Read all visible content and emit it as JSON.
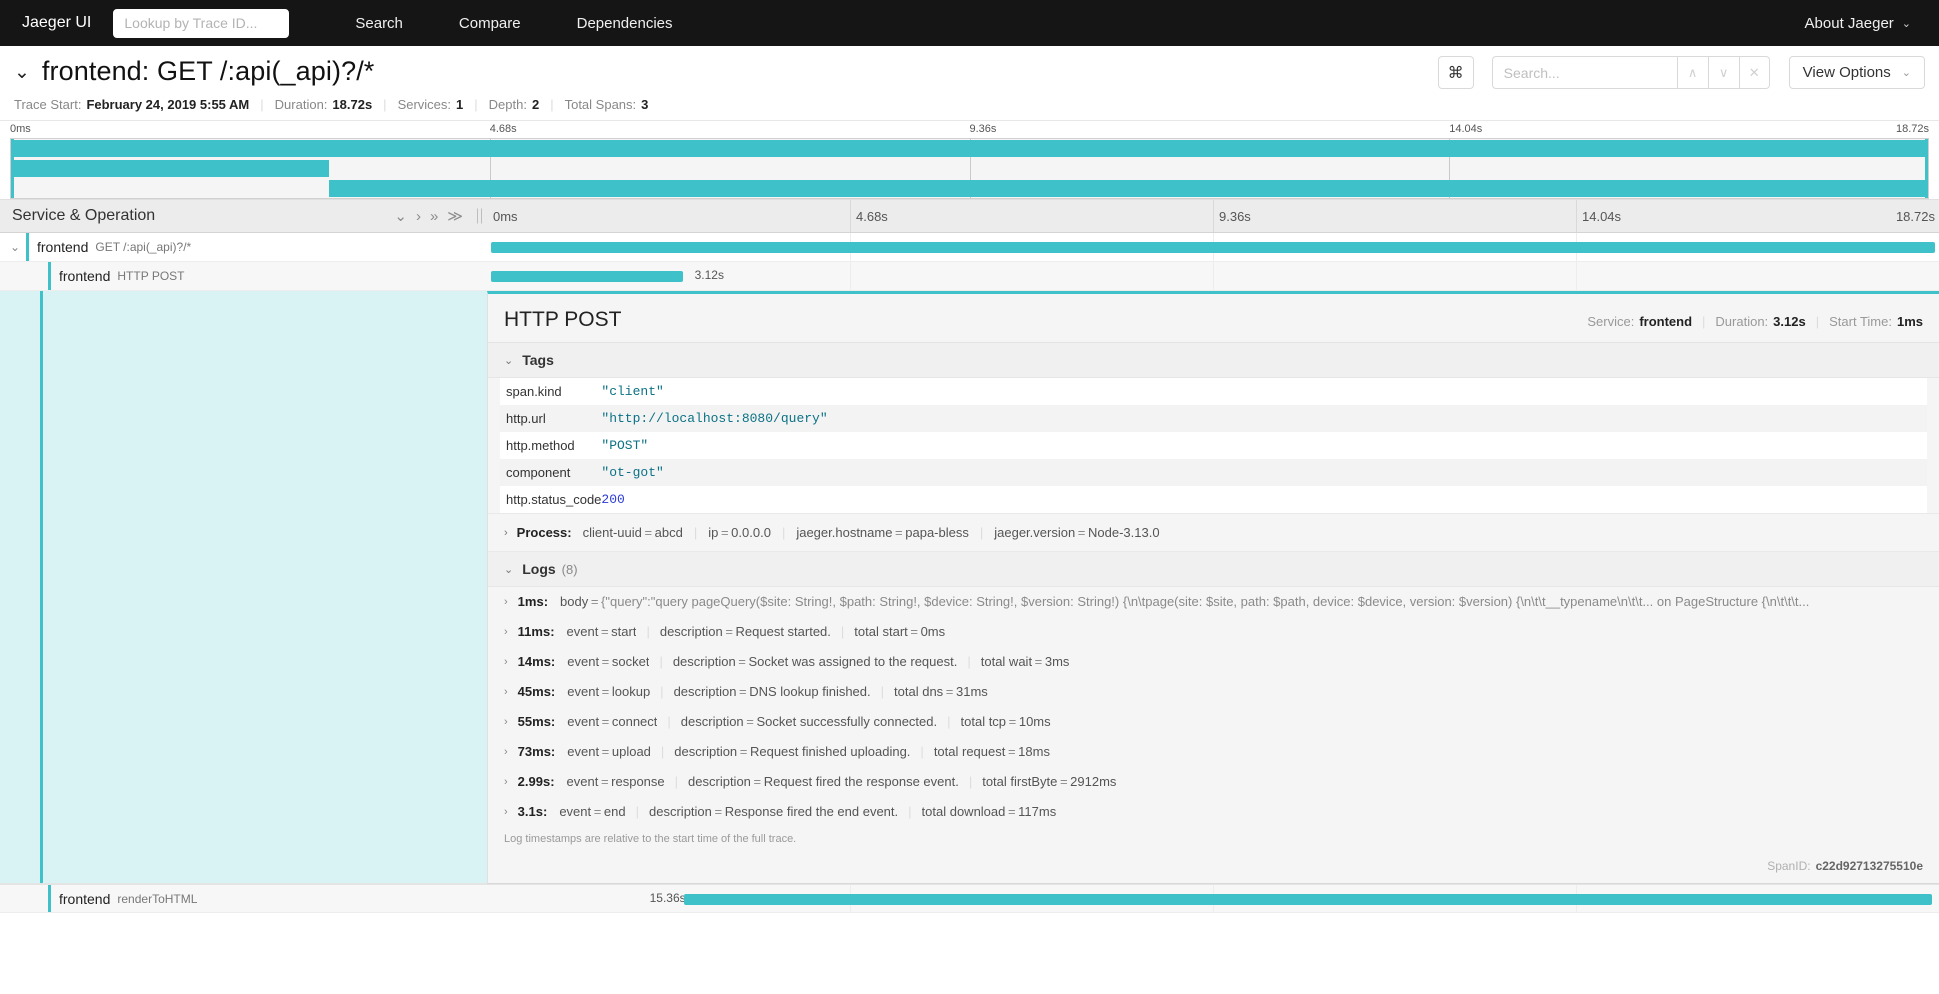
{
  "topnav": {
    "brand": "Jaeger UI",
    "trace_lookup_placeholder": "Lookup by Trace ID...",
    "trace_lookup_value": "",
    "links": [
      {
        "label": "Search"
      },
      {
        "label": "Compare"
      },
      {
        "label": "Dependencies"
      }
    ],
    "about": "About Jaeger",
    "about_caret": "⌄"
  },
  "trace": {
    "collapse_caret": "⌄",
    "title": "frontend: GET /:api(_api)?/*",
    "meta": [
      {
        "label": "Trace Start:",
        "value": "February 24, 2019 5:55 AM"
      },
      {
        "label": "Duration:",
        "value": "18.72s"
      },
      {
        "label": "Services:",
        "value": "1"
      },
      {
        "label": "Depth:",
        "value": "2"
      },
      {
        "label": "Total Spans:",
        "value": "3"
      }
    ]
  },
  "tools": {
    "kbd_icon": "⌘",
    "search_placeholder": "Search...",
    "search_value": "",
    "prev_icon": "∧",
    "next_icon": "∨",
    "clear_icon": "✕",
    "view_options": "View Options",
    "view_options_caret": "⌄"
  },
  "minimap": {
    "ticks": [
      {
        "label": "0ms",
        "pct": 0
      },
      {
        "label": "4.68s",
        "pct": 25
      },
      {
        "label": "9.36s",
        "pct": 50
      },
      {
        "label": "14.04s",
        "pct": 75
      },
      {
        "label": "18.72s",
        "pct": 100
      }
    ],
    "rows": [
      {
        "left_pct": 0,
        "width_pct": 100
      },
      {
        "left_pct": 0,
        "width_pct": 16.6
      },
      {
        "left_pct": 16.6,
        "width_pct": 83.4
      }
    ]
  },
  "columns": {
    "left_header": "Service & Operation",
    "actions": [
      {
        "icon": "⌄",
        "name": "collapse-one-icon"
      },
      {
        "icon": "›",
        "name": "expand-one-icon"
      },
      {
        "icon": "»",
        "name": "collapse-all-icon"
      },
      {
        "icon": "≫",
        "name": "expand-all-icon"
      }
    ],
    "ticks": [
      {
        "label": "0ms",
        "pct": 0
      },
      {
        "label": "4.68s",
        "pct": 25
      },
      {
        "label": "9.36s",
        "pct": 50
      },
      {
        "label": "14.04s",
        "pct": 75
      },
      {
        "label": "18.72s",
        "pct": 100
      }
    ]
  },
  "spans": [
    {
      "caret": "⌄",
      "service": "frontend",
      "operation": "GET /:api(_api)?/*",
      "bar_left_pct": 0,
      "bar_width_pct": 100,
      "duration_label": "",
      "indent": 0
    },
    {
      "caret": "",
      "service": "frontend",
      "operation": "HTTP POST",
      "bar_left_pct": 0,
      "bar_width_pct": 16.8,
      "duration_label": "3.12s",
      "indent": 1
    },
    {
      "caret": "",
      "service": "frontend",
      "operation": "renderToHTML",
      "bar_left_pct": 12.9,
      "bar_width_pct": 87.1,
      "duration_label": "15.36s",
      "indent": 1
    }
  ],
  "detail": {
    "title": "HTTP POST",
    "meta": [
      {
        "label": "Service:",
        "value": "frontend"
      },
      {
        "label": "Duration:",
        "value": "3.12s"
      },
      {
        "label": "Start Time:",
        "value": "1ms"
      }
    ],
    "tags_header": "Tags",
    "tags_caret": "⌄",
    "tags": [
      {
        "key": "span.kind",
        "value": "\"client\"",
        "kind": "string"
      },
      {
        "key": "http.url",
        "value": "\"http://localhost:8080/query\"",
        "kind": "string"
      },
      {
        "key": "http.method",
        "value": "\"POST\"",
        "kind": "string"
      },
      {
        "key": "component",
        "value": "\"ot-got\"",
        "kind": "string"
      },
      {
        "key": "http.status_code",
        "value": "200",
        "kind": "number"
      }
    ],
    "process": {
      "caret": "›",
      "label": "Process:",
      "fields": [
        {
          "key": "client-uuid",
          "value": "abcd"
        },
        {
          "key": "ip",
          "value": "0.0.0.0"
        },
        {
          "key": "jaeger.hostname",
          "value": "papa-bless"
        },
        {
          "key": "jaeger.version",
          "value": "Node-3.13.0"
        }
      ]
    },
    "logs_header": "Logs",
    "logs_count": "(8)",
    "logs_caret": "⌄",
    "logs": [
      {
        "caret": "›",
        "timestamp": "1ms:",
        "fields": [
          {
            "key": "body",
            "value": "{\"query\":\"query pageQuery($site: String!, $path: String!, $device: String!, $version: String!) {\\n\\tpage(site: $site, path: $path, device: $device, version: $version) {\\n\\t\\t__typename\\n\\t\\t... on PageStructure {\\n\\t\\t\\t..."
          }
        ]
      },
      {
        "caret": "›",
        "timestamp": "11ms:",
        "fields": [
          {
            "key": "event",
            "value": "start"
          },
          {
            "key": "description",
            "value": "Request started."
          },
          {
            "key": "total start",
            "value": "0ms"
          }
        ]
      },
      {
        "caret": "›",
        "timestamp": "14ms:",
        "fields": [
          {
            "key": "event",
            "value": "socket"
          },
          {
            "key": "description",
            "value": "Socket was assigned to the request."
          },
          {
            "key": "total wait",
            "value": "3ms"
          }
        ]
      },
      {
        "caret": "›",
        "timestamp": "45ms:",
        "fields": [
          {
            "key": "event",
            "value": "lookup"
          },
          {
            "key": "description",
            "value": "DNS lookup finished."
          },
          {
            "key": "total dns",
            "value": "31ms"
          }
        ]
      },
      {
        "caret": "›",
        "timestamp": "55ms:",
        "fields": [
          {
            "key": "event",
            "value": "connect"
          },
          {
            "key": "description",
            "value": "Socket successfully connected."
          },
          {
            "key": "total tcp",
            "value": "10ms"
          }
        ]
      },
      {
        "caret": "›",
        "timestamp": "73ms:",
        "fields": [
          {
            "key": "event",
            "value": "upload"
          },
          {
            "key": "description",
            "value": "Request finished uploading."
          },
          {
            "key": "total request",
            "value": "18ms"
          }
        ]
      },
      {
        "caret": "›",
        "timestamp": "2.99s:",
        "fields": [
          {
            "key": "event",
            "value": "response"
          },
          {
            "key": "description",
            "value": "Request fired the response event."
          },
          {
            "key": "total firstByte",
            "value": "2912ms"
          }
        ]
      },
      {
        "caret": "›",
        "timestamp": "3.1s:",
        "fields": [
          {
            "key": "event",
            "value": "end"
          },
          {
            "key": "description",
            "value": "Response fired the end event."
          },
          {
            "key": "total download",
            "value": "117ms"
          }
        ]
      }
    ],
    "logs_note": "Log timestamps are relative to the start time of the full trace.",
    "spanid_label": "SpanID:",
    "spanid_value": "c22d92713275510e"
  },
  "colors": {
    "accent": "#3fc1c9",
    "nav_bg": "#151515",
    "panel_bg": "#f5f5f5",
    "string_value": "#0b7285",
    "number_value": "#2b3bd6"
  }
}
